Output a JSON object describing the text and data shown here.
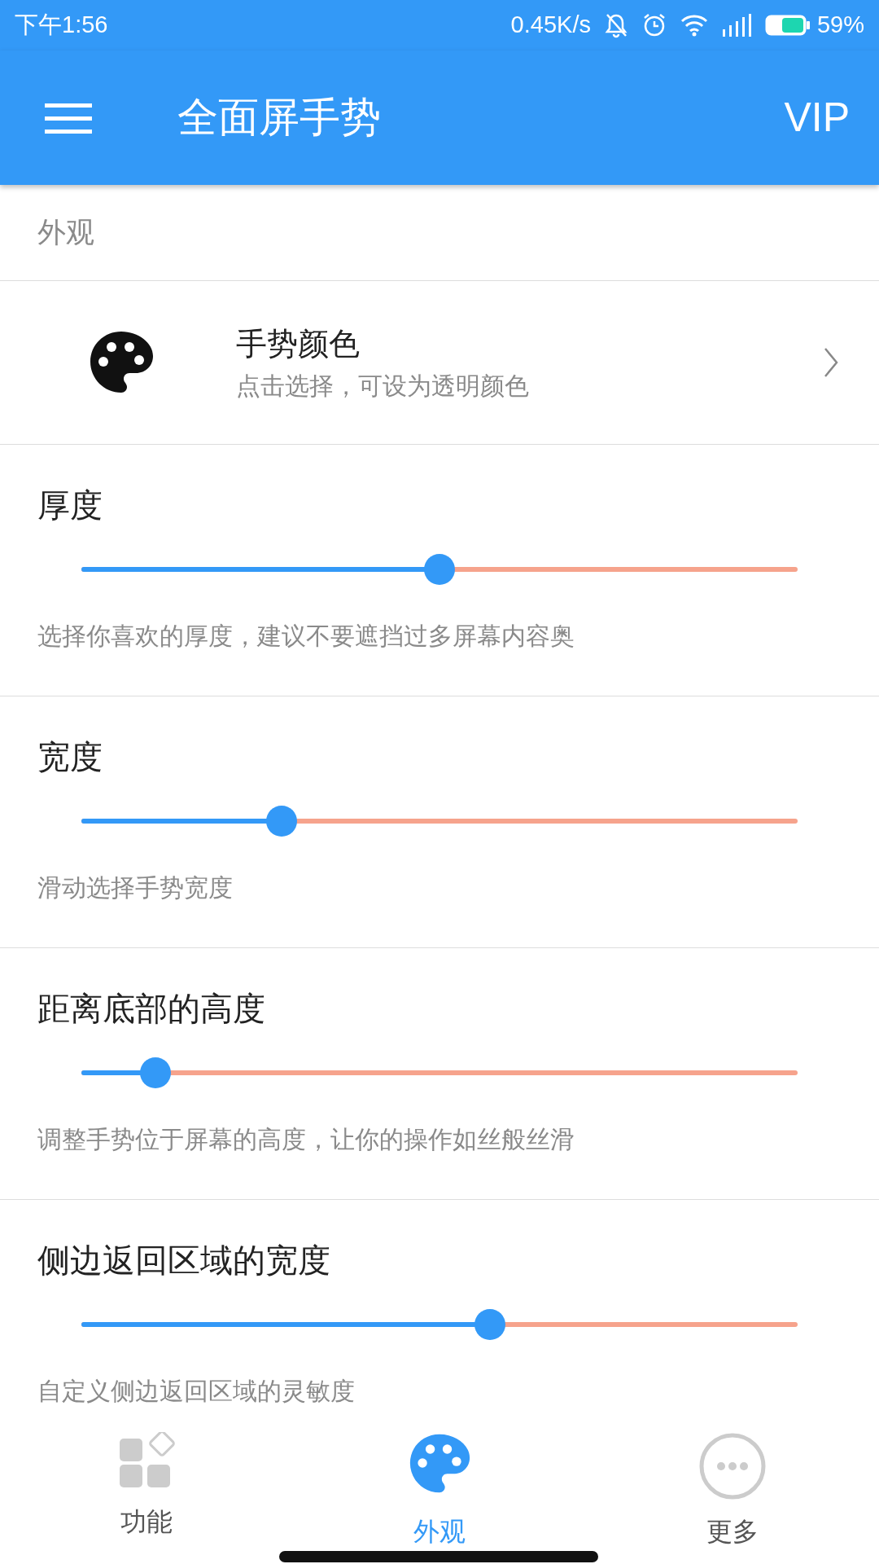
{
  "status_bar": {
    "time": "下午1:56",
    "speed": "0.45K/s",
    "battery_percent": "59%"
  },
  "app_bar": {
    "title": "全面屏手势",
    "action": "VIP"
  },
  "section_header": "外观",
  "color_item": {
    "title": "手势颜色",
    "subtitle": "点击选择，可设为透明颜色"
  },
  "sliders": [
    {
      "label": "厚度",
      "level": 0.5,
      "description": "选择你喜欢的厚度，建议不要遮挡过多屏幕内容奥"
    },
    {
      "label": "宽度",
      "level": 0.28,
      "description": "滑动选择手势宽度"
    },
    {
      "label": "距离底部的高度",
      "level": 0.103,
      "description": "调整手势位于屏幕的高度，让你的操作如丝般丝滑"
    },
    {
      "label": "侧边返回区域的宽度",
      "level": 0.571,
      "description": "自定义侧边返回区域的灵敏度"
    }
  ],
  "bottom_nav": [
    {
      "label": "功能",
      "kind": "features",
      "selected": false
    },
    {
      "label": "外观",
      "kind": "appearance",
      "selected": true
    },
    {
      "label": "更多",
      "kind": "more",
      "selected": false
    }
  ]
}
